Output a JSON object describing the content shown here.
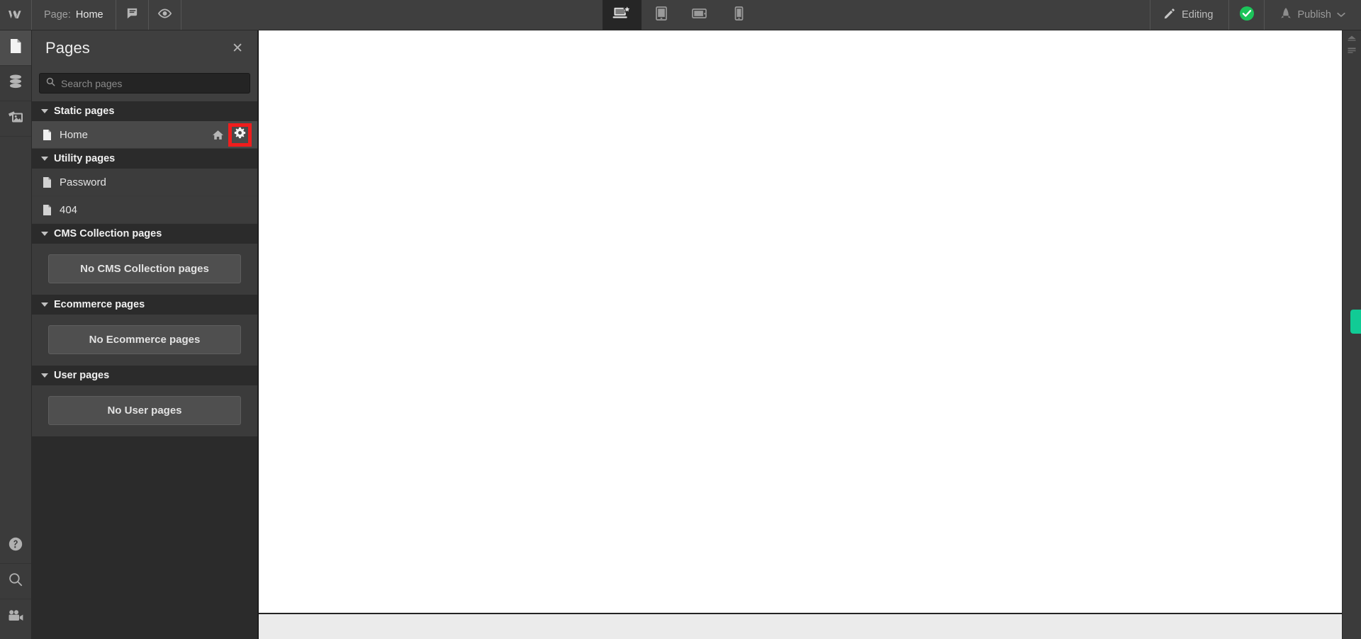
{
  "topbar": {
    "logo_icon": "webflow-logo-icon",
    "page_label": "Page:",
    "page_value": "Home",
    "comments_icon": "comment-bubble-icon",
    "preview_icon": "eye-preview-icon",
    "editing_label": "Editing",
    "editing_icon": "pencil-icon",
    "status_icon": "check-circle-icon",
    "status_color": "#1cc45a",
    "publish_label": "Publish",
    "publish_icon": "rocket-icon",
    "publish_caret_icon": "chevron-down-icon"
  },
  "viewports": [
    {
      "name": "desktop",
      "icon": "desktop-monitor-star-icon",
      "active": true
    },
    {
      "name": "tablet",
      "icon": "tablet-portrait-icon",
      "active": false
    },
    {
      "name": "tablet-landscape",
      "icon": "tablet-landscape-icon",
      "active": false
    },
    {
      "name": "mobile",
      "icon": "mobile-phone-icon",
      "active": false
    }
  ],
  "left_rail": {
    "top": [
      {
        "name": "pages",
        "icon": "page-document-icon",
        "active": true
      },
      {
        "name": "cms",
        "icon": "database-cms-icon",
        "active": false
      },
      {
        "name": "assets",
        "icon": "assets-images-icon",
        "active": false
      }
    ],
    "bottom": [
      {
        "name": "help",
        "icon": "question-help-icon"
      },
      {
        "name": "search",
        "icon": "magnifier-search-icon"
      },
      {
        "name": "video",
        "icon": "video-camera-icon"
      }
    ]
  },
  "panel": {
    "title": "Pages",
    "close_icon": "close-x-icon",
    "search": {
      "icon": "magnifier-search-icon",
      "value": "",
      "placeholder": "Search pages"
    },
    "sections": [
      {
        "name": "static-pages",
        "title": "Static pages",
        "expanded": true,
        "type": "list",
        "pages": [
          {
            "name": "Home",
            "icon": "page-document-icon",
            "is_home": true,
            "home_icon": "home-house-icon",
            "settings_icon": "gear-settings-icon",
            "settings_highlighted": true,
            "selected": true
          }
        ]
      },
      {
        "name": "utility-pages",
        "title": "Utility pages",
        "expanded": true,
        "type": "list",
        "pages": [
          {
            "name": "Password",
            "icon": "page-document-icon",
            "is_home": false,
            "selected": false
          },
          {
            "name": "404",
            "icon": "page-document-icon",
            "is_home": false,
            "selected": false
          }
        ]
      },
      {
        "name": "cms-collection-pages",
        "title": "CMS Collection pages",
        "expanded": true,
        "type": "empty",
        "empty_label": "No CMS Collection pages"
      },
      {
        "name": "ecommerce-pages",
        "title": "Ecommerce pages",
        "expanded": true,
        "type": "empty",
        "empty_label": "No Ecommerce pages"
      },
      {
        "name": "user-pages",
        "title": "User pages",
        "expanded": true,
        "type": "empty",
        "empty_label": "No User pages"
      }
    ]
  },
  "right_rail": {
    "icons": [
      {
        "name": "style-manager",
        "icon": "style-panel-icon"
      },
      {
        "name": "settings-panel",
        "icon": "settings-panel-icon"
      }
    ],
    "tab": {
      "name": "audit-tab",
      "color": "#11cb95"
    }
  },
  "canvas": {
    "background": "#ebebeb",
    "page_background": "#ffffff"
  },
  "colors": {
    "topbar_bg": "#3f3f3f",
    "panel_bg": "#2b2b2b",
    "row_selected": "#494949",
    "highlight_red": "#f01d1d",
    "accent_green": "#11cb95"
  }
}
